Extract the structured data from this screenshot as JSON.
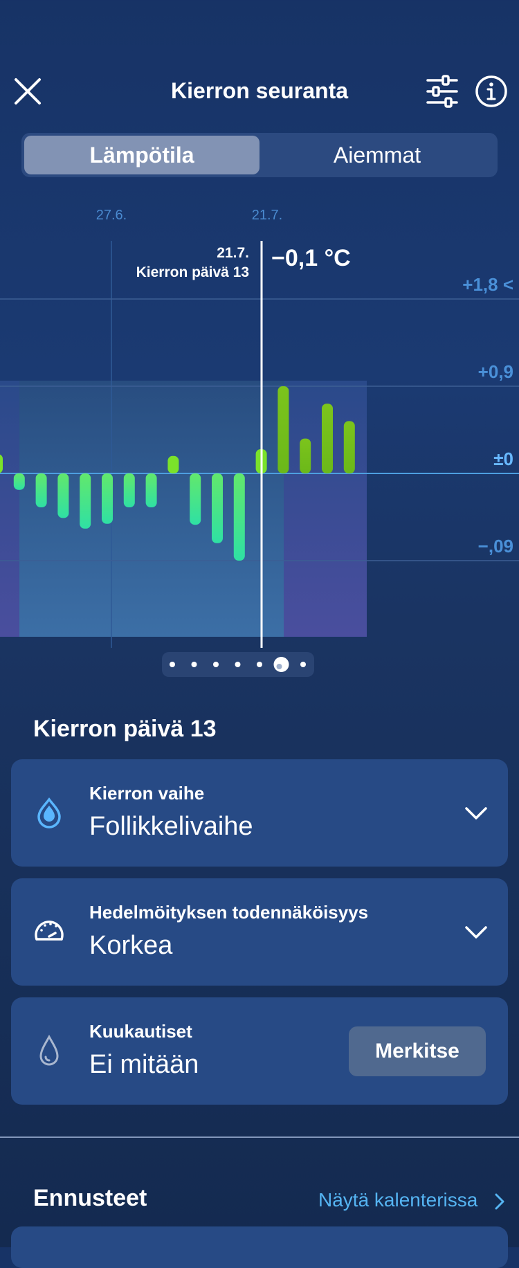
{
  "header": {
    "title": "Kierron seuranta",
    "close_icon": "close-icon",
    "filter_icon": "sliders-icon",
    "info_icon": "info-icon"
  },
  "tabs": [
    {
      "label": "Lämpötila",
      "active": true
    },
    {
      "label": "Aiemmat",
      "active": false
    }
  ],
  "chart_data": {
    "type": "bar",
    "x_tick_labels": [
      "27.6.",
      "21.7."
    ],
    "y_tick_labels": [
      "+1,8 <",
      "+0,9",
      "±0",
      "−,09"
    ],
    "y_ticks": [
      0.18,
      0.09,
      0,
      -0.09
    ],
    "ylim": [
      -0.16,
      0.2
    ],
    "selected": {
      "date": "21.7.",
      "cycle_day": "Kierron päivä 13",
      "value_label": "−0,1 °C"
    },
    "values": [
      0.02,
      -0.017,
      -0.035,
      -0.046,
      -0.057,
      -0.052,
      -0.035,
      -0.035,
      0.018,
      -0.053,
      -0.072,
      -0.09,
      0.025,
      0.09,
      0.036,
      0.072,
      0.054
    ],
    "colors": {
      "negative": "#5ce57a",
      "positive": "#7dc51b",
      "axis": "#4d9fe0",
      "grid": "#3c5f94",
      "label": "#4a90d8",
      "zero_label": "#68b8ff"
    }
  },
  "pager": {
    "count": 7,
    "active_index": 5
  },
  "day_section": {
    "title": "Kierron päivä 13"
  },
  "cards": [
    {
      "label": "Kierron vaihe",
      "value": "Follikkelivaihe",
      "icon": "drop-icon",
      "action": "chevron-down-icon"
    },
    {
      "label": "Hedelmöityksen todennäköisyys",
      "value": "Korkea",
      "icon": "gauge-icon",
      "action": "chevron-down-icon"
    },
    {
      "label": "Kuukautiset",
      "value": "Ei mitään",
      "icon": "outline-drop-icon",
      "button": "Merkitse"
    }
  ],
  "forecast": {
    "title": "Ennusteet",
    "link": "Näytä kalenterissa",
    "link_icon": "chevron-right-icon"
  }
}
